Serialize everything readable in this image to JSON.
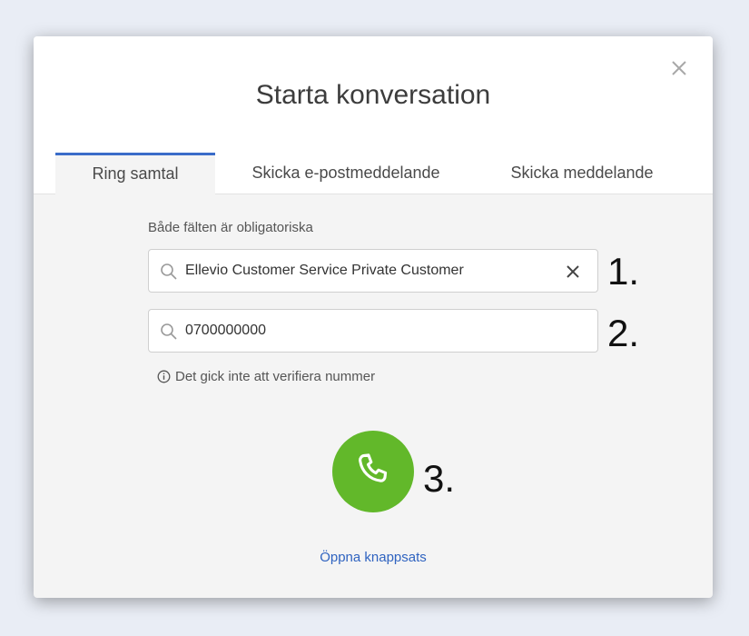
{
  "dialog": {
    "title": "Starta konversation",
    "close_icon": "close-icon"
  },
  "tabs": [
    {
      "label": "Ring samtal",
      "active": true
    },
    {
      "label": "Skicka e-postmeddelande",
      "active": false
    },
    {
      "label": "Skicka meddelande",
      "active": false
    }
  ],
  "form": {
    "required_note": "Både fälten är obligatoriska",
    "contact_field": {
      "value": "Ellevio Customer Service Private Customer",
      "icon": "search-icon",
      "clear_icon": "close-icon"
    },
    "number_field": {
      "value": "0700000000",
      "icon": "search-icon"
    },
    "validation_message": "Det gick inte att verifiera nummer",
    "validation_icon": "info-icon"
  },
  "call_button": {
    "icon": "phone-icon",
    "color": "#62b82a"
  },
  "keypad_link": "Öppna knappsats",
  "annotations": [
    "1.",
    "2.",
    "3."
  ],
  "colors": {
    "accent": "#3a6cc9",
    "link": "#2f63c0"
  }
}
